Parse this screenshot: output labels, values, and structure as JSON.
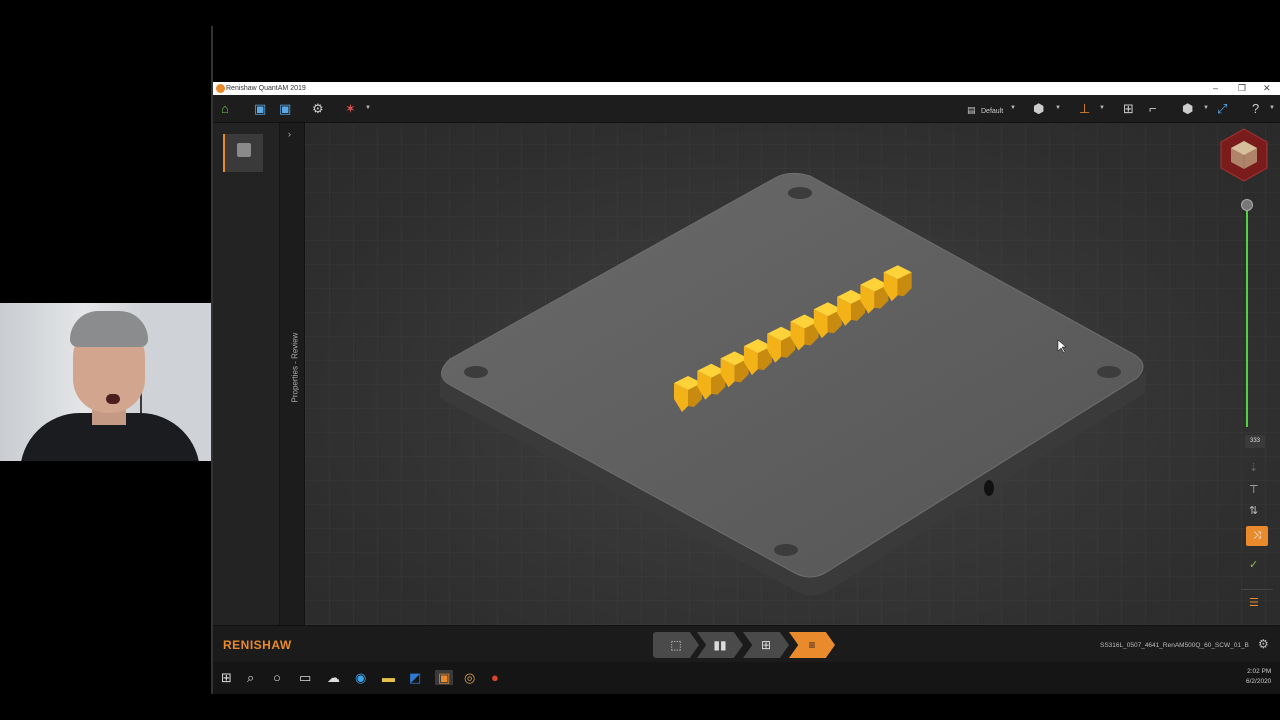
{
  "window": {
    "title": "Renishaw QuantAM 2019",
    "controls": [
      "–",
      "❐",
      "✕"
    ]
  },
  "toolbar": {
    "left_icons": [
      "home-icon",
      "save-icon",
      "save-as-icon",
      "gear-icon",
      "laser-icon"
    ],
    "view_preset_label": "Default"
  },
  "left_panel": {
    "properties_label": "Properties - Review",
    "expand_glyph": "›"
  },
  "right_tools": {
    "layer_value": "333"
  },
  "bottom_bar": {
    "logo_text": "RENISHAW",
    "filename": "SS316L_0507_4641_RenAM500Q_60_SCW_01_B",
    "workflow_steps": [
      {
        "name": "layout",
        "glyph": "⬚"
      },
      {
        "name": "supports",
        "glyph": "▮▮"
      },
      {
        "name": "scan",
        "glyph": "⊞"
      },
      {
        "name": "review",
        "glyph": "≡"
      }
    ],
    "active_step": 3
  },
  "taskbar": {
    "time": "2:02 PM",
    "date": "6/2/2020"
  },
  "colors": {
    "accent": "#e98a2c",
    "part": "#f3b318",
    "plate": "#5e5e5e",
    "slider": "#4dd43f"
  }
}
